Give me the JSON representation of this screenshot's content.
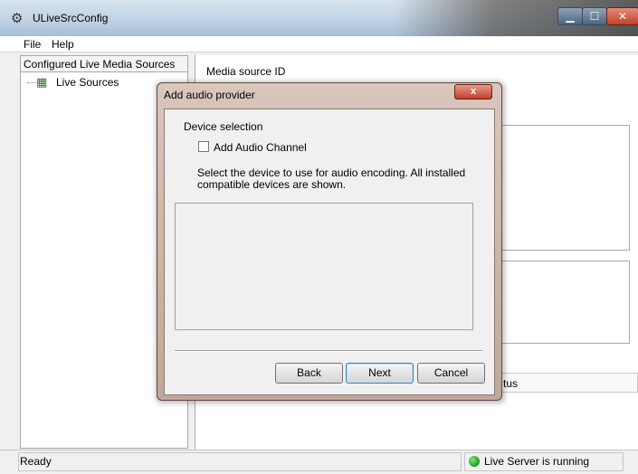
{
  "window": {
    "title": "ULiveSrcConfig",
    "icon": "app-icon"
  },
  "menu": {
    "items": [
      "File",
      "Help"
    ]
  },
  "left_panel": {
    "header": "Configured Live Media Sources",
    "tree": [
      {
        "label": "Live Sources",
        "icon": "folder-tree-icon"
      }
    ]
  },
  "right_panel": {
    "media_source_label": "Media source ID",
    "status_column_fragment": "tus"
  },
  "dialog": {
    "title": "Add audio provider",
    "section": "Device selection",
    "checkbox_label": "Add Audio Channel",
    "checkbox_checked": false,
    "description": "Select the device to use for audio encoding. All installed compatible devices are shown.",
    "buttons": {
      "back": "Back",
      "next": "Next",
      "cancel": "Cancel"
    },
    "close_glyph": "x"
  },
  "statusbar": {
    "left": "Ready",
    "right": "Live Server is running",
    "indicator_color": "#1e9a1e"
  }
}
